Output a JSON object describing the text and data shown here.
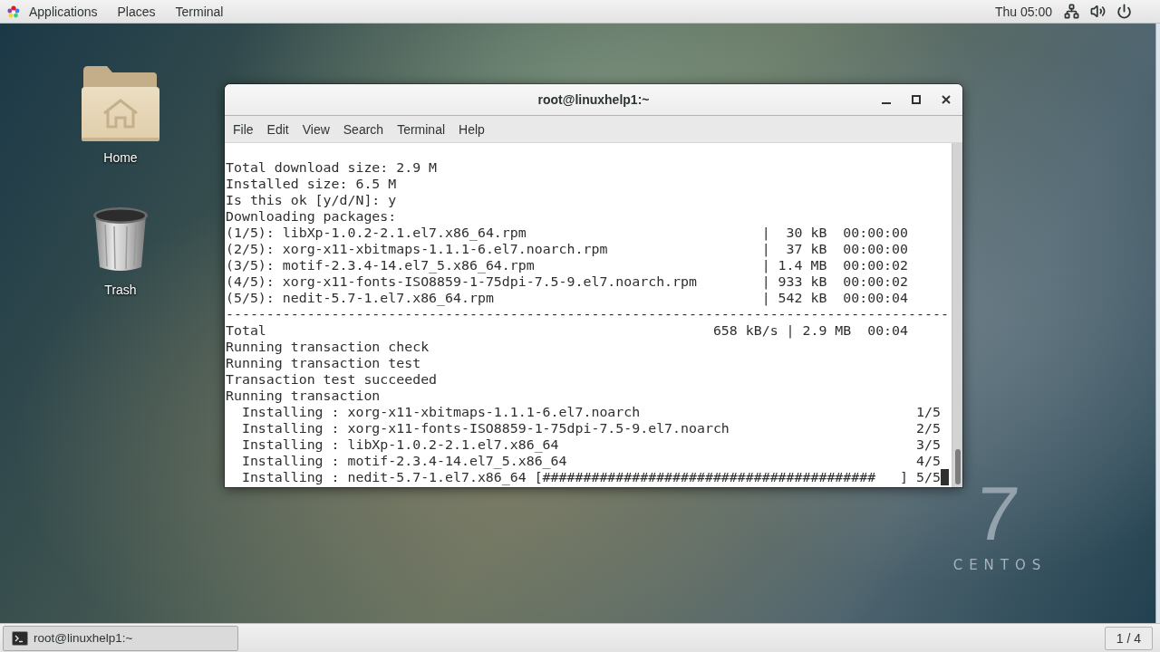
{
  "top_bar": {
    "menus": [
      {
        "kind": "launcher",
        "label": "Applications"
      },
      {
        "kind": "menu",
        "label": "Places"
      },
      {
        "kind": "menu",
        "label": "Terminal"
      }
    ],
    "clock": "Thu 05:00"
  },
  "desktop": {
    "icons": [
      {
        "kind": "home",
        "label": "Home"
      },
      {
        "kind": "trash",
        "label": "Trash"
      }
    ],
    "wallpaper_logo": {
      "numeral": "7",
      "wordmark": "CENTOS"
    }
  },
  "terminal_window": {
    "title": "root@linuxhelp1:~",
    "menu": [
      "File",
      "Edit",
      "View",
      "Search",
      "Terminal",
      "Help"
    ],
    "output": [
      {
        "kind": "text",
        "text": "Total download size: 2.9 M"
      },
      {
        "kind": "text",
        "text": "Installed size: 6.5 M"
      },
      {
        "kind": "text",
        "text": "Is this ok [y/d/N]: y"
      },
      {
        "kind": "text",
        "text": "Downloading packages:"
      },
      {
        "kind": "download",
        "file": "(1/5): libXp-1.0.2-2.1.el7.x86_64.rpm",
        "separator": "|",
        "size": "30 kB",
        "time": "00:00:00"
      },
      {
        "kind": "download",
        "file": "(2/5): xorg-x11-xbitmaps-1.1.1-6.el7.noarch.rpm",
        "separator": "|",
        "size": "37 kB",
        "time": "00:00:00"
      },
      {
        "kind": "download",
        "file": "(3/5): motif-2.3.4-14.el7_5.x86_64.rpm",
        "separator": "|",
        "size": "1.4 MB",
        "time": "00:00:02"
      },
      {
        "kind": "download",
        "file": "(4/5): xorg-x11-fonts-ISO8859-1-75dpi-7.5-9.el7.noarch.rpm",
        "separator": "|",
        "size": "933 kB",
        "time": "00:00:02"
      },
      {
        "kind": "download",
        "file": "(5/5): nedit-5.7-1.el7.x86_64.rpm",
        "separator": "|",
        "size": "542 kB",
        "time": "00:00:04"
      },
      {
        "kind": "rule",
        "text": "-----------------------------------------------------------------------------------------"
      },
      {
        "kind": "total",
        "label": "Total",
        "rate": "658 kB/s",
        "separator": "|",
        "size": "2.9 MB",
        "time": "00:04"
      },
      {
        "kind": "text",
        "text": "Running transaction check"
      },
      {
        "kind": "text",
        "text": "Running transaction test"
      },
      {
        "kind": "text",
        "text": "Transaction test succeeded"
      },
      {
        "kind": "text",
        "text": "Running transaction"
      },
      {
        "kind": "step",
        "text": "Installing : xorg-x11-xbitmaps-1.1.1-6.el7.noarch",
        "count": "1/5"
      },
      {
        "kind": "step",
        "text": "Installing : xorg-x11-fonts-ISO8859-1-75dpi-7.5-9.el7.noarch",
        "count": "2/5"
      },
      {
        "kind": "step",
        "text": "Installing : libXp-1.0.2-2.1.el7.x86_64",
        "count": "3/5"
      },
      {
        "kind": "step",
        "text": "Installing : motif-2.3.4-14.el7_5.x86_64",
        "count": "4/5"
      },
      {
        "kind": "step",
        "text": "Installing : nedit-5.7-1.el7.x86_64",
        "progress": "[#########################################   ]",
        "count": "5/5"
      }
    ],
    "cursor_visible": true
  },
  "taskbar": {
    "windows": [
      {
        "title": "root@linuxhelp1:~",
        "selected": true
      }
    ],
    "workspace": "1 / 4"
  }
}
